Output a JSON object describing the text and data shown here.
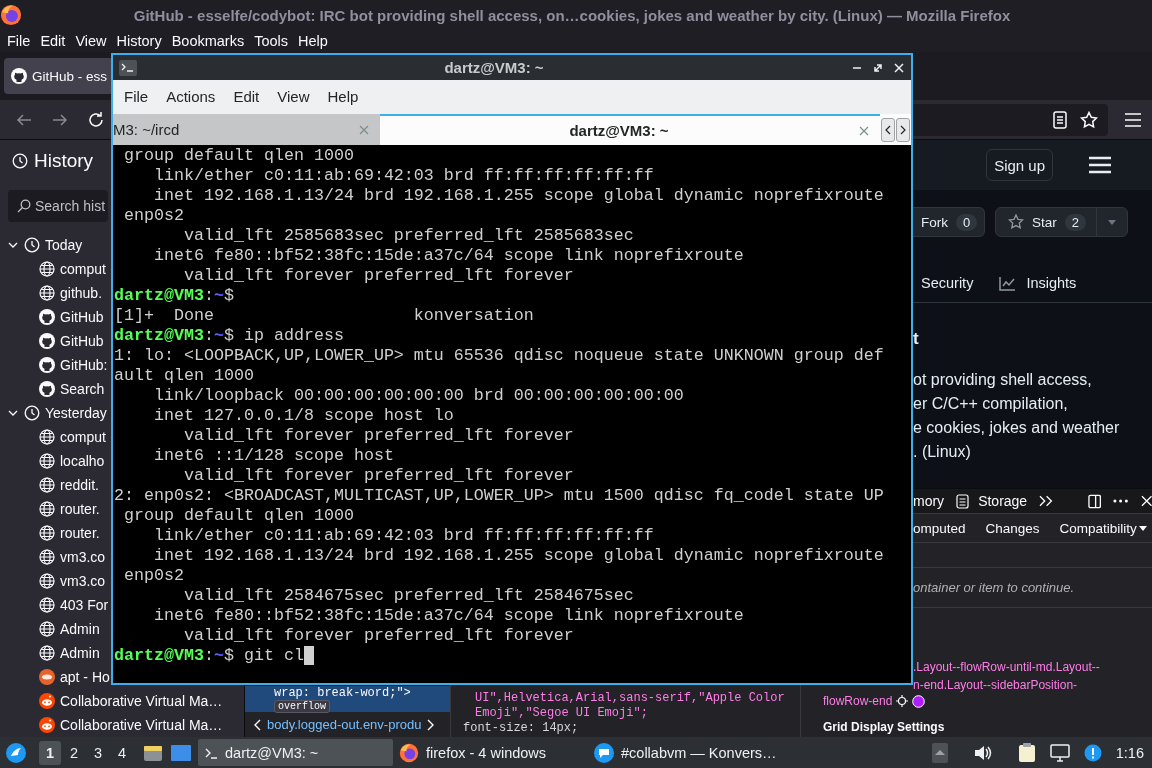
{
  "firefox": {
    "title": "GitHub - esselfe/codybot: IRC bot providing shell access, on…cookies, jokes and weather by city. (Linux) — Mozilla Firefox",
    "menu": [
      "File",
      "Edit",
      "View",
      "History",
      "Bookmarks",
      "Tools",
      "Help"
    ],
    "tabs": [
      {
        "label": "GitHub - ess",
        "selected": true
      }
    ],
    "sidebar": {
      "title": "History",
      "search": {
        "placeholder": "Search hist"
      },
      "groups": [
        {
          "label": "Today",
          "expanded": true,
          "children": [
            {
              "label": "comput",
              "kind": "globe"
            },
            {
              "label": "github.",
              "kind": "globe"
            },
            {
              "label": "GitHub",
              "kind": "github"
            },
            {
              "label": "GitHub",
              "kind": "github"
            },
            {
              "label": "GitHub:",
              "kind": "github"
            },
            {
              "label": "Search",
              "kind": "github"
            }
          ]
        },
        {
          "label": "Yesterday",
          "expanded": true,
          "children": [
            {
              "label": "comput",
              "kind": "globe"
            },
            {
              "label": "localho",
              "kind": "globe"
            },
            {
              "label": "reddit.",
              "kind": "globe"
            },
            {
              "label": "router.",
              "kind": "globe"
            },
            {
              "label": "router.",
              "kind": "globe"
            },
            {
              "label": "vm3.co",
              "kind": "globe"
            },
            {
              "label": "vm3.co",
              "kind": "globe"
            },
            {
              "label": "403 For",
              "kind": "globe"
            },
            {
              "label": "Admin",
              "kind": "globe"
            },
            {
              "label": "Admin",
              "kind": "globe"
            },
            {
              "label": "apt - Ho",
              "kind": "ask"
            },
            {
              "label": "Collaborative Virtual Ma…",
              "kind": "reddit"
            },
            {
              "label": "Collaborative Virtual Ma…",
              "kind": "reddit"
            }
          ]
        }
      ]
    },
    "page": {
      "sign_up": "Sign up",
      "repo_buttons": [
        {
          "label": "Fork",
          "count": "0",
          "kind": "fork"
        },
        {
          "label": "Star",
          "count": "2",
          "kind": "star"
        }
      ],
      "nav": [
        {
          "label": "Security"
        },
        {
          "label": "Insights",
          "kind": "graph"
        }
      ],
      "about": {
        "heading": "t",
        "lines": [
          "ot providing shell access,",
          "er C/C++ compilation,",
          "e cookies, jokes and weather",
          ". (Linux)"
        ]
      }
    },
    "devtools": {
      "tools": [
        {
          "label": "mory"
        },
        {
          "label": "Storage",
          "kind": "storage"
        }
      ],
      "markup": {
        "line": "wrap: break-word;\">",
        "badge": "overflow",
        "breadcrumb": "body.logged-out.env-produ"
      },
      "rules": [
        {
          "kind": "value",
          "text": "UI\",Helvetica,Arial,sans-serif,\"Apple Color"
        },
        {
          "kind": "value",
          "text": "Emoji\",\"Segoe UI Emoji\";"
        },
        {
          "kind": "declaration",
          "text": "font-size: 14px;"
        }
      ],
      "sidebar": {
        "tabs": [
          {
            "label": "omputed",
            "selected": false
          },
          {
            "label": "Changes",
            "selected": false
          },
          {
            "label": "Compatibility",
            "selected": false
          }
        ],
        "message": "ontainer or item to continue.",
        "selectors": [
          ".Layout--flowRow-until-md.Layout--",
          "n-end.Layout--sidebarPosition-"
        ],
        "selector_end": "flowRow-end",
        "section": "Grid Display Settings"
      }
    }
  },
  "terminal": {
    "title": "dartz@VM3: ~",
    "menu": [
      "File",
      "Actions",
      "Edit",
      "View",
      "Help"
    ],
    "tabs": [
      {
        "label": "M3: ~/ircd",
        "selected": false
      },
      {
        "label": "dartz@VM3: ~",
        "selected": true
      }
    ],
    "lines": [
      {
        "kind": "output",
        "text": " group default qlen 1000"
      },
      {
        "kind": "output",
        "text": "    link/ether c0:11:ab:69:42:03 brd ff:ff:ff:ff:ff:ff"
      },
      {
        "kind": "output",
        "text": "    inet 192.168.1.13/24 brd 192.168.1.255 scope global dynamic noprefixroute"
      },
      {
        "kind": "output",
        "text": " enp0s2"
      },
      {
        "kind": "output",
        "text": "       valid_lft 2585683sec preferred_lft 2585683sec"
      },
      {
        "kind": "output",
        "text": "    inet6 fe80::bf52:38fc:15de:a37c/64 scope link noprefixroute"
      },
      {
        "kind": "output",
        "text": "       valid_lft forever preferred_lft forever"
      },
      {
        "kind": "prompt",
        "user": "dartz@VM3",
        "separator": ":",
        "path": "~",
        "symbol": "$"
      },
      {
        "kind": "output",
        "text": "[1]+  Done                    konversation"
      },
      {
        "kind": "prompt",
        "user": "dartz@VM3",
        "separator": ":",
        "path": "~",
        "symbol": "$",
        "command": "ip address"
      },
      {
        "kind": "output",
        "text": "1: lo: <LOOPBACK,UP,LOWER_UP> mtu 65536 qdisc noqueue state UNKNOWN group def"
      },
      {
        "kind": "output",
        "text": "ault qlen 1000"
      },
      {
        "kind": "output",
        "text": "    link/loopback 00:00:00:00:00:00 brd 00:00:00:00:00:00"
      },
      {
        "kind": "output",
        "text": "    inet 127.0.0.1/8 scope host lo"
      },
      {
        "kind": "output",
        "text": "       valid_lft forever preferred_lft forever"
      },
      {
        "kind": "output",
        "text": "    inet6 ::1/128 scope host"
      },
      {
        "kind": "output",
        "text": "       valid_lft forever preferred_lft forever"
      },
      {
        "kind": "output",
        "text": "2: enp0s2: <BROADCAST,MULTICAST,UP,LOWER_UP> mtu 1500 qdisc fq_codel state UP"
      },
      {
        "kind": "output",
        "text": " group default qlen 1000"
      },
      {
        "kind": "output",
        "text": "    link/ether c0:11:ab:69:42:03 brd ff:ff:ff:ff:ff:ff"
      },
      {
        "kind": "output",
        "text": "    inet 192.168.1.13/24 brd 192.168.1.255 scope global dynamic noprefixroute"
      },
      {
        "kind": "output",
        "text": " enp0s2"
      },
      {
        "kind": "output",
        "text": "       valid_lft 2584675sec preferred_lft 2584675sec"
      },
      {
        "kind": "output",
        "text": "    inet6 fe80::bf52:38fc:15de:a37c/64 scope link noprefixroute"
      },
      {
        "kind": "output",
        "text": "       valid_lft forever preferred_lft forever"
      },
      {
        "kind": "prompt",
        "user": "dartz@VM3",
        "separator": ":",
        "path": "~",
        "symbol": "$",
        "command": "git cl",
        "cursor": true
      }
    ]
  },
  "taskbar": {
    "workspaces": [
      {
        "label": "1",
        "selected": true
      },
      {
        "label": "2",
        "selected": false
      },
      {
        "label": "3",
        "selected": false
      },
      {
        "label": "4",
        "selected": false
      }
    ],
    "tasks": [
      {
        "label": "dartz@VM3: ~",
        "kind": "terminal",
        "selected": true
      },
      {
        "label": "firefox - 4 windows",
        "kind": "firefox",
        "selected": false
      },
      {
        "label": "#collabvm — Konvers…",
        "kind": "chat",
        "selected": false
      }
    ],
    "clock": "1:16"
  }
}
